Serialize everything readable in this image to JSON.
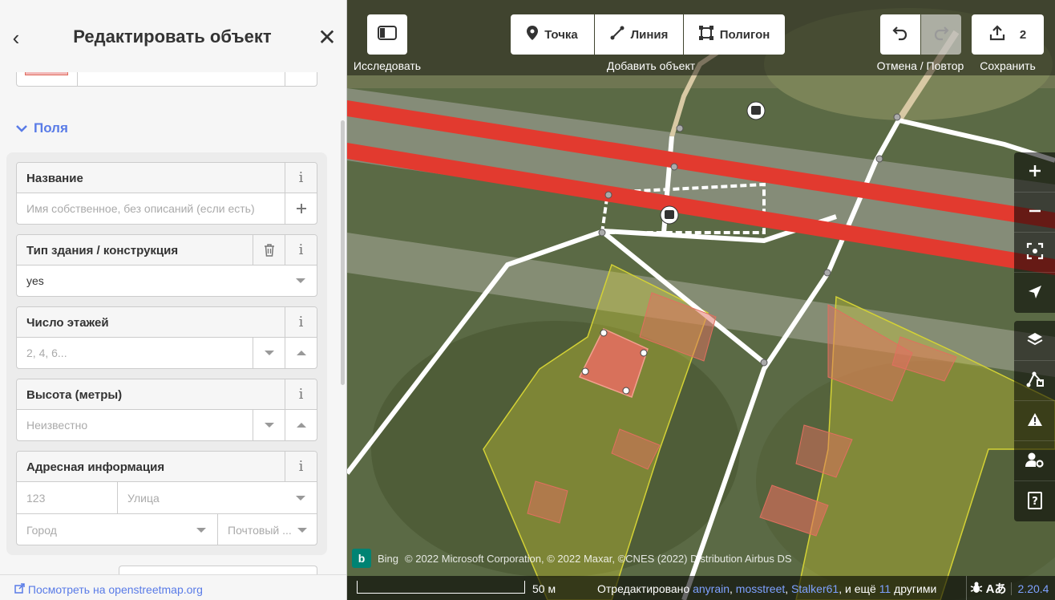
{
  "sidebar": {
    "title": "Редактировать объект",
    "fields_toggle": "Поля",
    "fields": {
      "name": {
        "label": "Название",
        "placeholder": "Имя собственное, без описаний (если есть)"
      },
      "building": {
        "label": "Тип здания / конструкция",
        "value": "yes"
      },
      "levels": {
        "label": "Число этажей",
        "placeholder": "2, 4, 6..."
      },
      "height": {
        "label": "Высота (метры)",
        "placeholder": "Неизвестно"
      },
      "address": {
        "label": "Адресная информация",
        "housenumber_placeholder": "123",
        "street_placeholder": "Улица",
        "city_placeholder": "Город",
        "postcode_placeholder": "Почтовый ..."
      }
    },
    "osm_link": "Посмотреть на openstreetmap.org"
  },
  "toolbar": {
    "explore_label": "Исследовать",
    "point_label": "Точка",
    "line_label": "Линия",
    "area_label": "Полигон",
    "add_feature_label": "Добавить объект",
    "undo_redo_label": "Отмена / Повтор",
    "save_count": "2",
    "save_label": "Сохранить"
  },
  "map": {
    "attribution": "© 2022 Microsoft Corporation, © 2022 Maxar, ©CNES (2022) Distribution Airbus DS",
    "bing_label": "Bing",
    "scale_label": "50 м",
    "edited_by_prefix": "Отредактировано",
    "editors": [
      "anyrain",
      "mosstreet",
      "Stalker61"
    ],
    "edited_by_more_prefix": ", и ещё",
    "edited_by_more_count": "11",
    "edited_by_more_suffix": "другими",
    "version": "2.20.4"
  },
  "icons": [
    "back-icon",
    "close-icon",
    "info-icon",
    "trash-icon",
    "plus-icon",
    "caret-icon",
    "panel-icon",
    "point-icon",
    "line-icon",
    "area-icon",
    "undo-icon",
    "redo-icon",
    "upload-icon",
    "zoom-in-icon",
    "zoom-out-icon",
    "zoom-to-selection-icon",
    "geolocate-icon",
    "layers-icon",
    "map-data-icon",
    "issues-icon",
    "preferences-icon",
    "help-icon",
    "bug-icon",
    "translate-icon",
    "external-link-icon"
  ],
  "colors": {
    "accent": "#597be7",
    "road": "#e23a2f",
    "selected": "#e06e5f",
    "landuse": "#d4d235"
  }
}
